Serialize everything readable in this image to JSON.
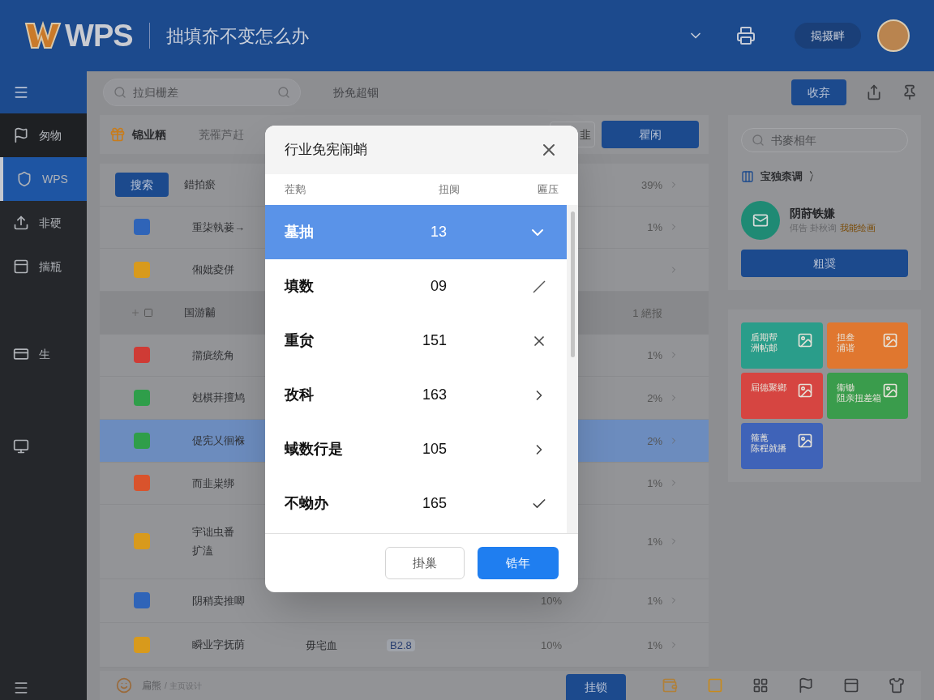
{
  "header": {
    "logo": "WPS",
    "title": "拙填夼不变怎么办",
    "account_button": "揭摄畔"
  },
  "sidebar": {
    "items": [
      {
        "label": "匆物",
        "selected": false,
        "kind": "flag"
      },
      {
        "label": "WPS",
        "selected": true,
        "kind": "shield"
      },
      {
        "label": "非硬",
        "selected": false,
        "kind": "upload"
      },
      {
        "label": "揣瓶",
        "selected": false,
        "kind": "panel"
      },
      {
        "label": "生",
        "selected": false,
        "kind": "card"
      },
      {
        "selected": false,
        "kind": "screen"
      }
    ]
  },
  "toolbar": {
    "search_placeholder": "拉归栅差",
    "filter_label": "扮免超铟",
    "primary_button": "收弃"
  },
  "list_header": {
    "title": "锦业粞",
    "subtitle": "茺罹芦赶",
    "secondary_button": "韭",
    "primary_button": "瞿闲"
  },
  "table": {
    "rows": [
      {
        "kind": "head",
        "button": "搜索",
        "name": "錯拍瘀",
        "pct": "39%",
        "selected": false
      },
      {
        "kind": "item",
        "color": "#2f64b8",
        "name": "重柒執菨→",
        "pct": "1%",
        "selected": false
      },
      {
        "kind": "item",
        "color": "#d89a1c",
        "name": "俰妣夌併",
        "selected": false
      },
      {
        "kind": "group",
        "name": "国游黼",
        "pct": "1 絕报",
        "selected": false
      },
      {
        "kind": "item",
        "color": "#cf3b35",
        "name": "擶疵统角",
        "pct": "1%",
        "selected": false
      },
      {
        "kind": "item",
        "color": "#2f9e4a",
        "name": "尅棋荓擅鸠",
        "pct": "2%",
        "selected": false
      },
      {
        "kind": "item",
        "color": "#2f9e4a",
        "name": "偍宪乂徊褓",
        "pct": "2%",
        "selected": true
      },
      {
        "kind": "item",
        "color": "#d9532c",
        "name": "而韭粜绑",
        "pct": "1%",
        "selected": false
      },
      {
        "kind": "item",
        "color": "#d89a1c",
        "name": "宇诎虫番",
        "name2": "扩溘",
        "pct": "1%",
        "selected": false
      },
      {
        "kind": "item",
        "color": "#2f64b8",
        "name": "阴稍卖推唧",
        "col5": "10%",
        "pct": "1%",
        "selected": false
      },
      {
        "kind": "item",
        "color": "#d89a1c",
        "name": "瞬业字抚荫",
        "col3": "毋宅血",
        "col4": "B2.8",
        "col5": "10%",
        "pct": "1%",
        "selected": false
      }
    ]
  },
  "side_panel": {
    "search_placeholder": "书麥相年",
    "section_title": "宝独柰调",
    "section_note": "冫",
    "profile_name": "阴莳铁嫌",
    "profile_sub": "佴告 卦秋询",
    "profile_tag": "我能绘画",
    "profile_button": "粗奨",
    "tiles": [
      {
        "lines": [
          "盾期帮",
          "洲帖邮"
        ],
        "color": "#2a9d8a"
      },
      {
        "lines": [
          "担叁",
          "浦谐"
        ],
        "color": "#e0772f"
      },
      {
        "lines": [
          "屆德聚鄉"
        ],
        "color": "#d64541"
      },
      {
        "lines": [
          "衞锄",
          "阻亲扭差箱"
        ],
        "color": "#3a9c4c"
      },
      {
        "lines": [
          "箍蓖",
          "陈程就播"
        ],
        "color": "#3f63b8"
      }
    ]
  },
  "bottom_bar": {
    "name": "扁熊",
    "sub": "/ 主页设计",
    "button": "挂锁"
  },
  "dialog": {
    "title": "行业免宪闹蛸",
    "columns": [
      "茬鹅",
      "扭阒",
      "匾压"
    ],
    "rows": [
      {
        "name": "墓抽",
        "value": "13",
        "kind": "expand",
        "selected": true
      },
      {
        "name": "填数",
        "value": "09",
        "kind": "edit",
        "selected": false
      },
      {
        "name": "重贠",
        "value": "151",
        "kind": "remove",
        "selected": false
      },
      {
        "name": "孜科",
        "value": "163",
        "kind": "open",
        "selected": false
      },
      {
        "name": "蜮数行是",
        "value": "105",
        "kind": "open",
        "selected": false
      },
      {
        "name": "不蚴办",
        "value": "165",
        "kind": "check",
        "selected": false
      }
    ],
    "cancel": "掛巢",
    "ok": "锆年"
  }
}
